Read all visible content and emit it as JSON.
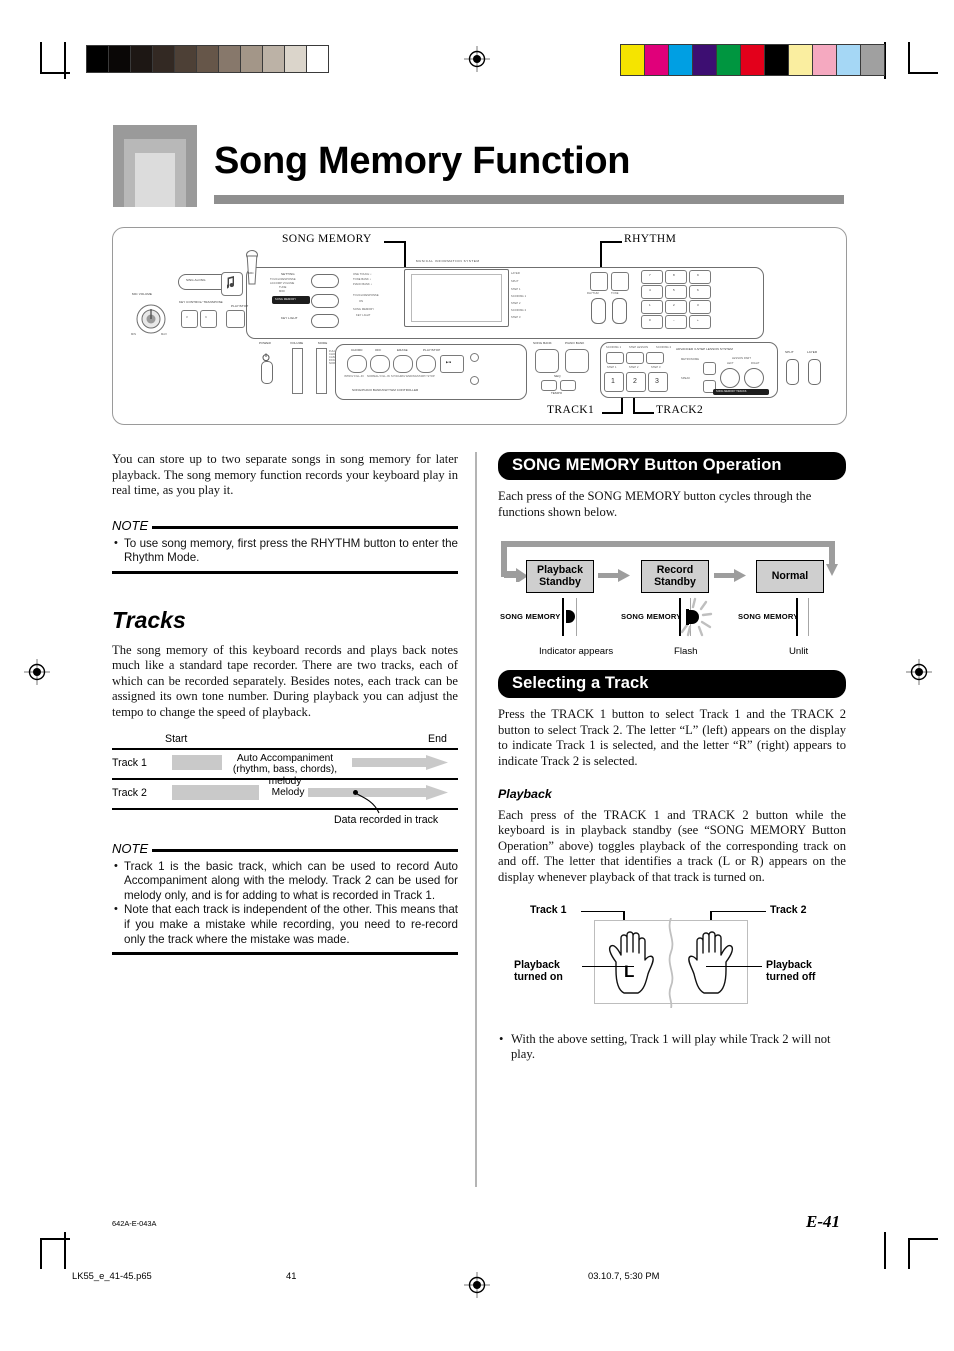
{
  "page": {
    "title": "Song Memory Function",
    "footer_code": "642A-E-043A",
    "page_number": "E-41",
    "file_name": "LK55_e_41-45.p65",
    "sheet_number": "41",
    "timestamp": "03.10.7, 5:30 PM"
  },
  "calibration": {
    "gray_swatches": [
      "#000000",
      "#0a0706",
      "#1d1714",
      "#332923",
      "#4d4036",
      "#665649",
      "#87786b",
      "#a39688",
      "#bcb2a6",
      "#dbd5cb",
      "#ffffff"
    ],
    "color_swatches": [
      "#f5e400",
      "#e0007a",
      "#009fe3",
      "#3d0e72",
      "#009640",
      "#e3001b",
      "#000000",
      "#faeea0",
      "#f5a9c0",
      "#a5d7f5",
      "#a0a0a0"
    ]
  },
  "diagram": {
    "callouts": {
      "song_memory": "SONG MEMORY",
      "rhythm": "RHYTHM",
      "track1": "TRACK1",
      "track2": "TRACK2"
    },
    "panel_labels": {
      "mis": "MUSICAL INFORMATION SYSTEM",
      "sing_along": "SING ALONG",
      "mic": "MIC",
      "mic_volume": "MIC VOLUME",
      "key_control": "KEY CONTROL/ TRANSPOSE",
      "play_stop": "PLAY/STOP",
      "setting": "SETTING",
      "touch_response": "TOUCH RESPONSE",
      "accomp_volume": "ACCOMP VOLUME",
      "tune": "TUNE",
      "midi": "MIDI",
      "song_memory_btn": "SONG MEMORY",
      "key_light": "KEY LIGHT",
      "one_touch": "ONE TOUCH ♪",
      "tone_bank": "TONE BANK ♪",
      "piano_bank": "PIANO BANK ♪",
      "on": "ON",
      "layer": "LAYER",
      "split": "SPLIT",
      "step1": "STEP 1",
      "scoring1": "SCORING 1",
      "step2": "STEP 2",
      "scoring2": "SCORING 2",
      "step3": "STEP 3",
      "rhythm_btn": "RHYTHM",
      "tone_btn": "TONE",
      "power": "POWER",
      "volume": "VOLUME",
      "mode": "MODE",
      "mode_opts": "FULL RANGE CHORD / CASIO CHORD / FINGERED / NORMAL",
      "chord": "CHORD",
      "off": "OFF",
      "erase": "ERASE",
      "play_stop2": "PLAY/STOP",
      "intro": "INTRO/ FILL-IN",
      "normal_fillin": "NORMAL/ FILL-IN",
      "synchro": "SYNCHRO/ ENDING",
      "start_stop": "START/ STOP",
      "song_piano_rhythm": "SONG/PIANO BANK/RHYTHM CONTROLLER",
      "song_bank": "SONG BANK",
      "piano_bank2": "PIANO BANK",
      "seq": "SEQ",
      "tempo": "TEMPO",
      "scoring1b": "SCORING 1",
      "step_lesson": "STEP LESSON",
      "scoring2b": "SCORING 2",
      "advanced": "ADVANCED 3-STEP LESSON SYSTEM",
      "metronome": "METRONOME",
      "speak": "SPEAK",
      "lesson_part": "LESSON PART",
      "left": "LEFT",
      "right": "RIGHT",
      "song_memory_tracks": "SONG MEMORY TRACKS",
      "step1b": "STEP 1",
      "step2b": "STEP 2",
      "step3b": "STEP 3",
      "n1": "1",
      "n2": "2",
      "n3": "3",
      "split_b": "SPLIT",
      "layer_b": "LAYER",
      "kp7": "7",
      "kp8": "8",
      "kp9": "9",
      "kp4": "4",
      "kp5": "5",
      "kp6": "6",
      "kp1": "1",
      "kp2": "2",
      "kp3": "3",
      "kp0": "0",
      "kpm": "−",
      "kpp": "+"
    }
  },
  "left_column": {
    "intro": "You can store up to two separate songs in song memory for later playback. The song memory function records your keyboard play in real time, as you play it.",
    "note1": {
      "heading": "NOTE",
      "items": [
        "To use song memory, first press the RHYTHM button to enter the Rhythm Mode."
      ]
    },
    "tracks_heading": "Tracks",
    "tracks_body": "The song memory of this keyboard records and plays back notes much like a standard tape recorder. There are two tracks, each of which can be recorded separately. Besides notes, each track can be assigned its own tone number. During playback you can adjust the tempo to change the speed of playback.",
    "note2": {
      "heading": "NOTE",
      "items": [
        "Track 1 is the basic track, which can be used to record Auto Accompaniment along with the melody. Track 2 can be used for melody only, and is for adding to what is recorded in Track 1.",
        "Note that each track is independent of the other. This means that if you make a mistake while recording, you need to re-record only the track where the mistake was made."
      ]
    }
  },
  "track_chart": {
    "start_label": "Start",
    "end_label": "End",
    "rows": [
      {
        "name": "Track 1",
        "content_line1": "Auto Accompaniment",
        "content_line2": "(rhythm, bass, chords), melody"
      },
      {
        "name": "Track 2",
        "content_line1": "Melody",
        "content_line2": ""
      }
    ],
    "annotation": "Data recorded in track"
  },
  "right_column": {
    "banner1": "SONG MEMORY Button Operation",
    "banner1_body": "Each press of the SONG MEMORY button cycles through the functions shown below.",
    "cycle": {
      "steps": [
        {
          "box_line1": "Playback",
          "box_line2": "Standby",
          "button_label": "SONG MEMORY",
          "caption": "Indicator appears",
          "state": "lit"
        },
        {
          "box_line1": "Record",
          "box_line2": "Standby",
          "button_label": "SONG MEMORY",
          "caption": "Flash",
          "state": "flash"
        },
        {
          "box_line1": "Normal",
          "box_line2": "",
          "button_label": "SONG MEMORY",
          "caption": "Unlit",
          "state": "unlit"
        }
      ]
    },
    "banner2": "Selecting a Track",
    "banner2_body": "Press the TRACK 1 button to select Track 1 and the TRACK 2 button to select Track 2. The letter “L” (left) appears on the display to indicate Track 1 is selected, and the letter “R” (right) appears to indicate Track 2 is selected.",
    "playback_heading": "Playback",
    "playback_body": "Each press of the TRACK 1 and TRACK 2 button while the keyboard is in playback standby (see “SONG MEMORY Button Operation” above) toggles playback of the corresponding track on and off. The letter that identifies a track (L or R) appears on the display whenever playback of that track is turned on.",
    "hands": {
      "track1_label": "Track 1",
      "track2_label": "Track 2",
      "left_caption_line1": "Playback",
      "left_caption_line2": "turned on",
      "right_caption_line1": "Playback",
      "right_caption_line2": "turned off",
      "display_letter": "L"
    },
    "final_bullet": "With the above setting, Track 1 will play while Track 2 will not play."
  }
}
